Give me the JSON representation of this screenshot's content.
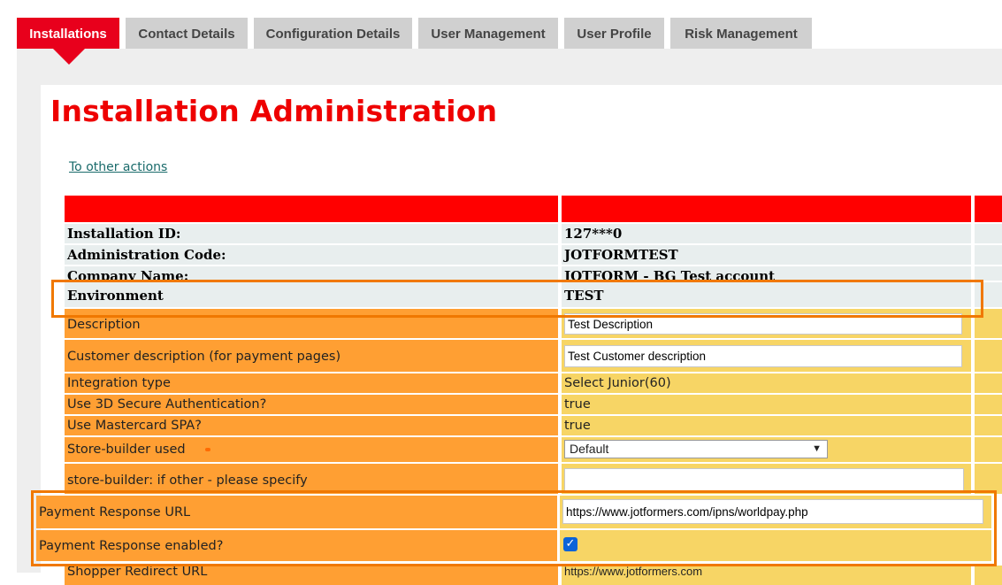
{
  "tabs": [
    {
      "label": "Installations",
      "active": true
    },
    {
      "label": "Contact Details",
      "active": false
    },
    {
      "label": "Configuration Details",
      "active": false
    },
    {
      "label": "User Management",
      "active": false
    },
    {
      "label": "User Profile",
      "active": false
    },
    {
      "label": "Risk Management",
      "active": false
    }
  ],
  "page": {
    "title": "Installation Administration",
    "back_link": "To other actions"
  },
  "info_rows": [
    {
      "label": "Installation ID:",
      "value": "127***0"
    },
    {
      "label": "Administration Code:",
      "value": "JOTFORMTEST"
    },
    {
      "label": "Company Name:",
      "value": "JOTFORM - BG Test account"
    },
    {
      "label": "Environment",
      "value": "TEST"
    }
  ],
  "form": {
    "description": {
      "label": "Description",
      "value": "Test Description"
    },
    "customer_description": {
      "label": "Customer description (for payment pages)",
      "value": "Test Customer description"
    },
    "integration_type": {
      "label": "Integration type",
      "value": "Select Junior(60)"
    },
    "secure_3d": {
      "label": "Use 3D Secure Authentication?",
      "value": "true"
    },
    "mastercard_spa": {
      "label": "Use Mastercard SPA?",
      "value": "true"
    },
    "store_builder": {
      "label": "Store-builder used",
      "selected": "Default"
    },
    "store_builder_other": {
      "label": "store-builder: if other - please specify",
      "value": ""
    },
    "payment_response_url": {
      "label": "Payment Response URL",
      "value": "https://www.jotformers.com/ipns/worldpay.php"
    },
    "payment_response_enabled": {
      "label": "Payment Response enabled?",
      "checked": true
    },
    "shopper_redirect_url": {
      "label": "Shopper Redirect URL",
      "value": "https://www.jotformers.com"
    }
  },
  "colors": {
    "brand_red": "#e8001c",
    "label_orange": "#ff9f33",
    "value_yellow": "#f7d565",
    "highlight": "#f07800",
    "checkbox_blue": "#0a63d8"
  }
}
